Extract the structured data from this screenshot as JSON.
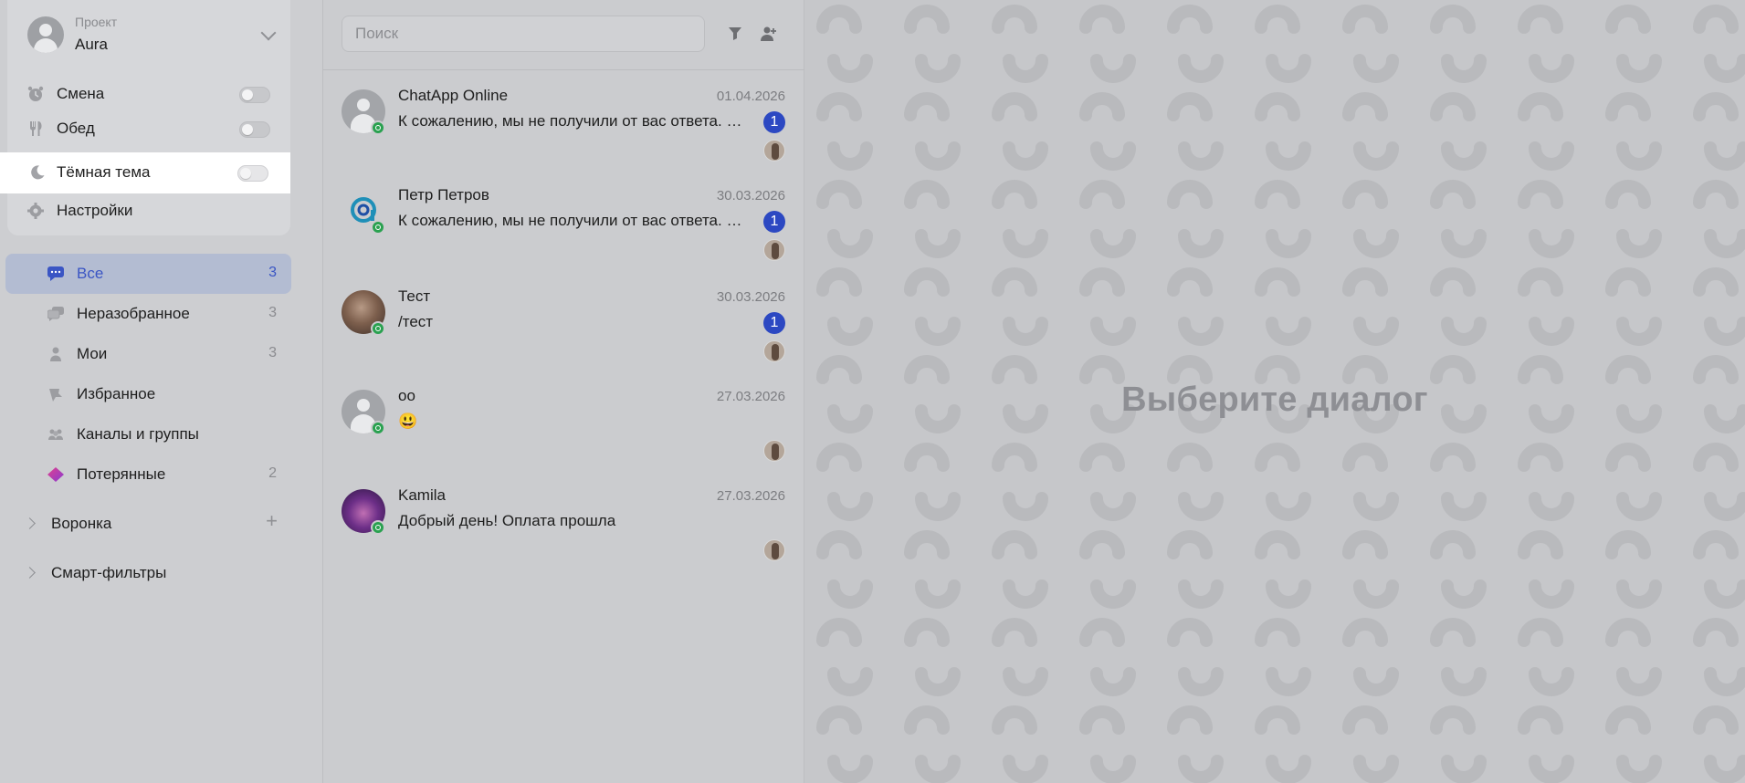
{
  "sidebar": {
    "project": {
      "label": "Проект",
      "name": "Aura"
    },
    "shift": {
      "label": "Смена"
    },
    "lunch": {
      "label": "Обед"
    },
    "dark_theme": {
      "label": "Тёмная тема"
    },
    "settings": {
      "label": "Настройки"
    },
    "nav": [
      {
        "label": "Все",
        "count": "3"
      },
      {
        "label": "Неразобранное",
        "count": "3"
      },
      {
        "label": "Мои",
        "count": "3"
      },
      {
        "label": "Избранное",
        "count": ""
      },
      {
        "label": "Каналы и группы",
        "count": ""
      },
      {
        "label": "Потерянные",
        "count": "2"
      }
    ],
    "groups": [
      {
        "label": "Воронка"
      },
      {
        "label": "Смарт-фильтры"
      }
    ]
  },
  "chat_list": {
    "search_placeholder": "Поиск",
    "chats": [
      {
        "name": "ChatApp Online",
        "date": "01.04.2026",
        "message": "К сожалению, мы не получили от вас ответа. …",
        "unread": "1"
      },
      {
        "name": "Петр Петров",
        "date": "30.03.2026",
        "message": "К сожалению, мы не получили от вас ответа. …",
        "unread": "1"
      },
      {
        "name": "Тест",
        "date": "30.03.2026",
        "message": "/тест",
        "unread": "1"
      },
      {
        "name": "оо",
        "date": "27.03.2026",
        "message": "😃",
        "unread": ""
      },
      {
        "name": "Kamila",
        "date": "27.03.2026",
        "message": "Добрый день! Оплата прошла",
        "unread": ""
      }
    ]
  },
  "dialog": {
    "placeholder": "Выберите диалог"
  },
  "colors": {
    "accent": "#2c48c2",
    "active_nav_bg": "#b3bcd2",
    "whatsapp": "#2aa150"
  }
}
